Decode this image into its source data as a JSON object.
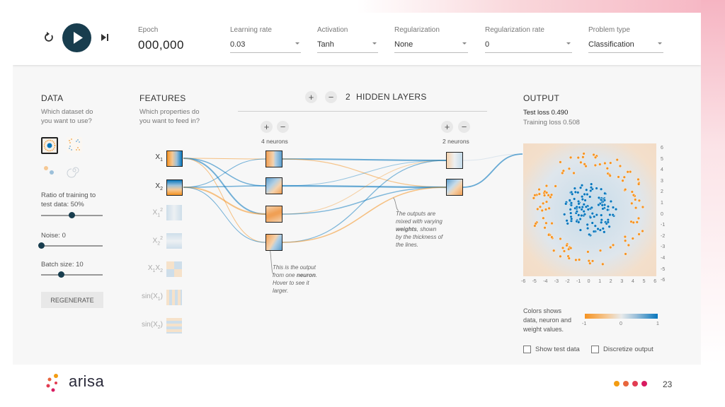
{
  "controls": {
    "epoch": {
      "label": "Epoch",
      "value": "000,000"
    },
    "learning_rate": {
      "label": "Learning rate",
      "value": "0.03"
    },
    "activation": {
      "label": "Activation",
      "value": "Tanh"
    },
    "regularization": {
      "label": "Regularization",
      "value": "None"
    },
    "regularization_rate": {
      "label": "Regularization rate",
      "value": "0"
    },
    "problem_type": {
      "label": "Problem type",
      "value": "Classification"
    }
  },
  "data_panel": {
    "title": "DATA",
    "question_line1": "Which dataset do",
    "question_line2": "you want to use?",
    "ratio_label_line1": "Ratio of training to",
    "ratio_label_line2": "test data:  50%",
    "ratio_value": 0.5,
    "noise_label": "Noise:  0",
    "noise_value": 0,
    "batch_label": "Batch size:  10",
    "batch_value": 0.33,
    "regenerate": "REGENERATE"
  },
  "features_panel": {
    "title": "FEATURES",
    "question_line1": "Which properties do",
    "question_line2": "you want to feed in?",
    "features": [
      {
        "base": "X",
        "sub": "1",
        "sup": "",
        "active": true
      },
      {
        "base": "X",
        "sub": "2",
        "sup": "",
        "active": true
      },
      {
        "base": "X",
        "sub": "1",
        "sup": "2",
        "active": false
      },
      {
        "base": "X",
        "sub": "2",
        "sup": "2",
        "active": false
      },
      {
        "base": "X",
        "sub": "1",
        "sup": "",
        "tail": "X",
        "tail_sub": "2",
        "active": false
      },
      {
        "base": "sin(X",
        "sub": "1",
        "sup": "",
        "close": ")",
        "active": false
      },
      {
        "base": "sin(X",
        "sub": "2",
        "sup": "",
        "close": ")",
        "active": false
      }
    ]
  },
  "network": {
    "hidden_count": "2",
    "hidden_label": "HIDDEN LAYERS",
    "layers": [
      {
        "neurons_label": "4 neurons",
        "count": 4
      },
      {
        "neurons_label": "2 neurons",
        "count": 2
      }
    ],
    "note_neuron": [
      "This is the output",
      "from one",
      "neuron",
      ".",
      "Hover to see it",
      "larger."
    ],
    "note_weights": [
      "The outputs are",
      "mixed with varying",
      "weights",
      ", shown",
      "by the thickness of",
      "the lines."
    ]
  },
  "output_panel": {
    "title": "OUTPUT",
    "test_loss": "Test loss 0.490",
    "training_loss": "Training loss 0.508",
    "y_ticks": [
      "6",
      "5",
      "4",
      "3",
      "2",
      "1",
      "0",
      "-1",
      "-2",
      "-3",
      "-4",
      "-5",
      "-6"
    ],
    "x_ticks": [
      "-6",
      "-5",
      "-4",
      "-3",
      "-2",
      "-1",
      "0",
      "1",
      "2",
      "3",
      "4",
      "5",
      "6"
    ],
    "legend_text": [
      "Colors shows",
      "data, neuron and",
      "weight values."
    ],
    "legend_ticks": [
      "-1",
      "0",
      "1"
    ],
    "show_test": "Show test data",
    "discretize": "Discretize output"
  },
  "footer": {
    "brand": "arisa",
    "page_number": "23"
  },
  "colors": {
    "orange": "#f59322",
    "blue": "#0877bd",
    "dark": "#183d4e",
    "brand_dots": [
      "#f39c12",
      "#e8663d",
      "#e23c52",
      "#d81b60"
    ]
  }
}
